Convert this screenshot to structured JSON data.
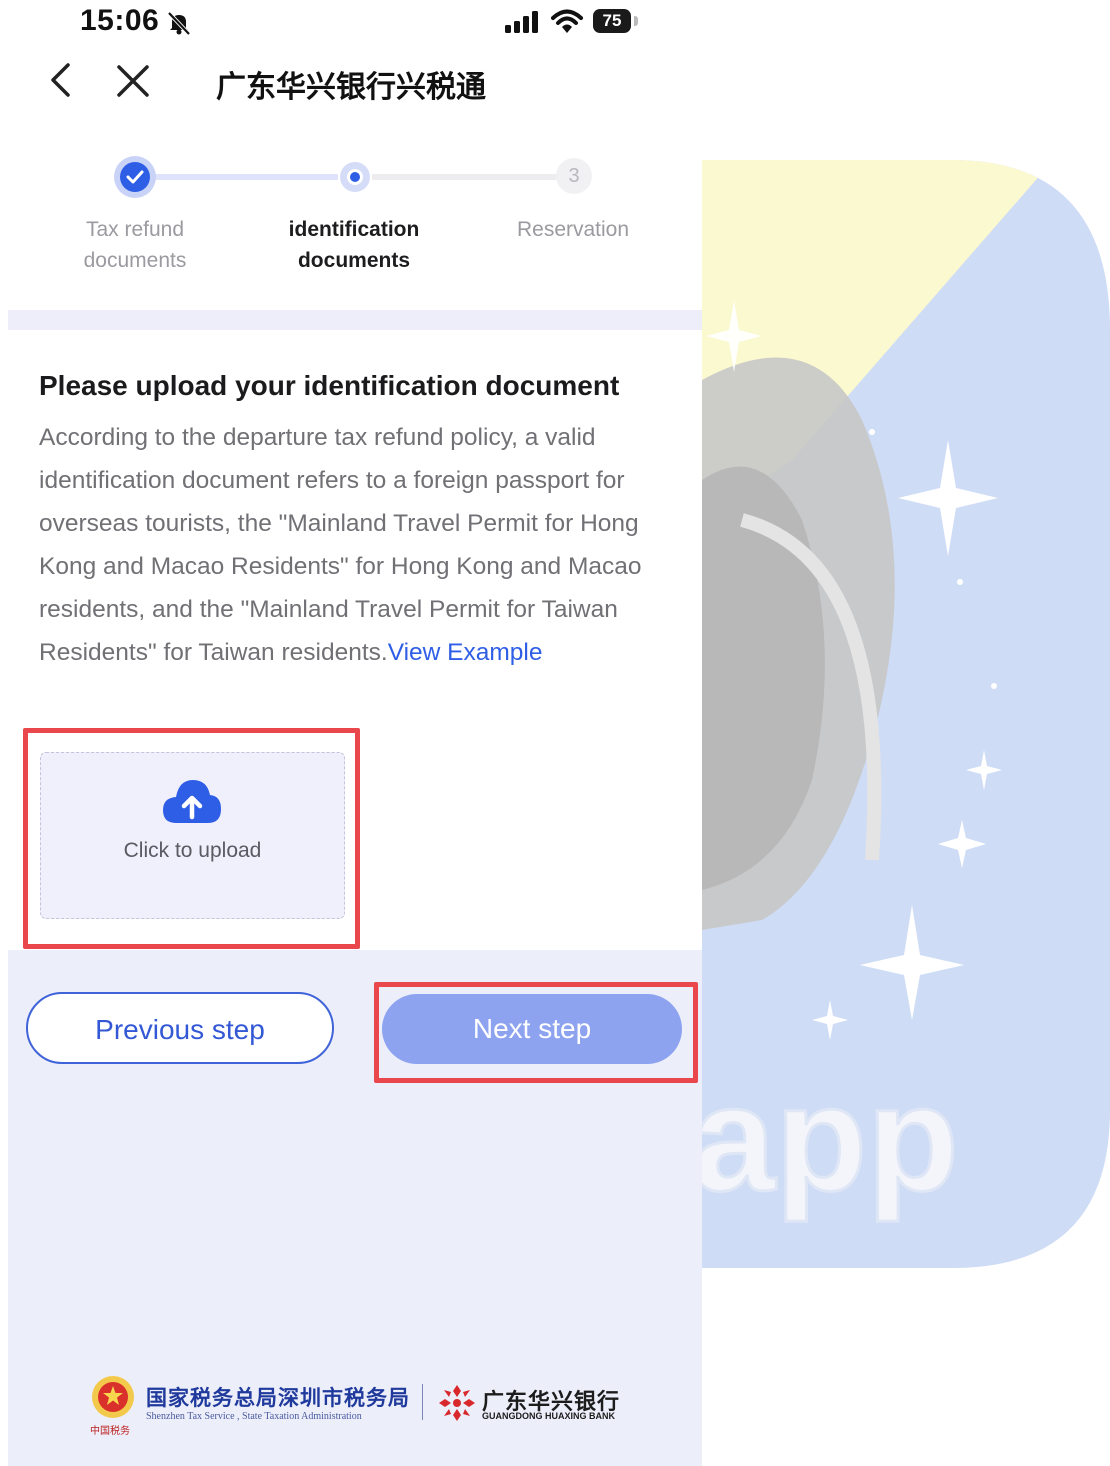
{
  "status_bar": {
    "time": "15:06",
    "battery": "75"
  },
  "nav": {
    "title": "广东华兴银行兴税通"
  },
  "stepper": {
    "steps": [
      {
        "label": "Tax refund documents",
        "state": "done"
      },
      {
        "label": "identification documents",
        "state": "current"
      },
      {
        "label": "Reservation",
        "state": "pending",
        "number": "3"
      }
    ]
  },
  "main": {
    "heading": "Please upload your identification document",
    "description": "According to the departure tax refund policy, a valid identification document refers to a foreign passport for overseas tourists, the \"Mainland Travel Permit for Hong Kong and Macao Residents\" for Hong Kong and Macao residents, and the \"Mainland Travel Permit for Taiwan Residents\" for Taiwan residents.",
    "view_example": "View Example",
    "upload_label": "Click to upload"
  },
  "actions": {
    "previous": "Previous step",
    "next": "Next step"
  },
  "footer": {
    "tax_name_cn": "国家税务总局深圳市税务局",
    "tax_name_en": "Shenzhen Tax Service , State Taxation Administration",
    "tax_seal": "中国税务",
    "bank_name_cn": "广东华兴银行",
    "bank_name_en": "GUANGDONG HUAXING BANK"
  },
  "background": {
    "watermark_text": "app"
  },
  "colors": {
    "accent": "#2f5ee6",
    "next_button": "#8da3f0",
    "highlight": "#e9474b",
    "page_bg": "#eceefa"
  }
}
